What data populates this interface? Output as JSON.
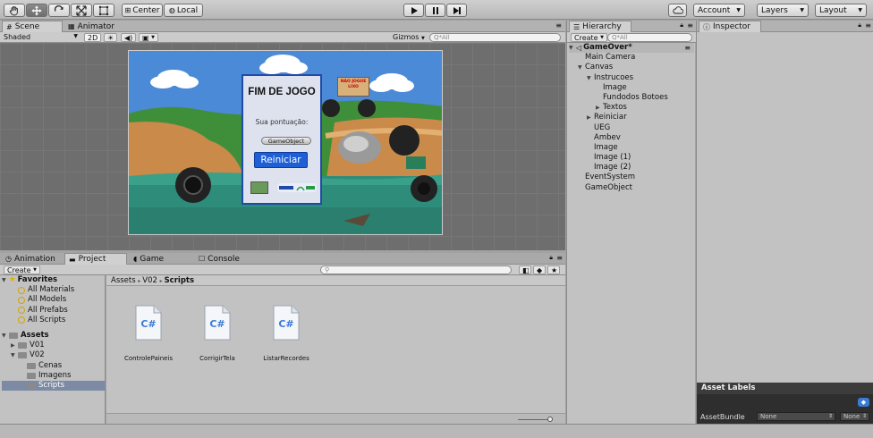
{
  "toolbar": {
    "center_label": "Center",
    "local_label": "Local",
    "account_label": "Account",
    "layers_label": "Layers",
    "layout_label": "Layout"
  },
  "scene_panel": {
    "tabs": [
      "Scene",
      "Animator"
    ],
    "shading": "Shaded",
    "mode_2d": "2D",
    "gizmos_label": "Gizmos",
    "search_placeholder": "Q*All"
  },
  "game_view": {
    "panel_title": "FIM DE JOGO",
    "score_label": "Sua pontuação:",
    "score_value": "GameObject",
    "restart_button": "Reiniciar",
    "sign_text": "NÃO JOGUE LIXO"
  },
  "hierarchy": {
    "tab": "Hierarchy",
    "create_label": "Create",
    "search_placeholder": "Q*All",
    "scene_name": "GameOver*",
    "items": [
      {
        "label": "Main Camera",
        "depth": 1,
        "arrow": ""
      },
      {
        "label": "Canvas",
        "depth": 1,
        "arrow": "down"
      },
      {
        "label": "Instrucoes",
        "depth": 2,
        "arrow": "down"
      },
      {
        "label": "Image",
        "depth": 3,
        "arrow": ""
      },
      {
        "label": "Fundodos Botoes",
        "depth": 3,
        "arrow": ""
      },
      {
        "label": "Textos",
        "depth": 3,
        "arrow": "right"
      },
      {
        "label": "Reiniciar",
        "depth": 2,
        "arrow": "right"
      },
      {
        "label": "UEG",
        "depth": 2,
        "arrow": ""
      },
      {
        "label": "Ambev",
        "depth": 2,
        "arrow": ""
      },
      {
        "label": "Image",
        "depth": 2,
        "arrow": ""
      },
      {
        "label": "Image (1)",
        "depth": 2,
        "arrow": ""
      },
      {
        "label": "Image (2)",
        "depth": 2,
        "arrow": ""
      },
      {
        "label": "EventSystem",
        "depth": 1,
        "arrow": ""
      },
      {
        "label": "GameObject",
        "depth": 1,
        "arrow": ""
      }
    ]
  },
  "inspector": {
    "tab": "Inspector",
    "asset_labels_title": "Asset Labels",
    "assetbundle_label": "AssetBundle",
    "assetbundle_value": "None",
    "variant_value": "None"
  },
  "bottom_panel": {
    "tabs": [
      "Animation",
      "Project",
      "Game",
      "Console"
    ],
    "create_label": "Create",
    "favorites": {
      "title": "Favorites",
      "items": [
        "All Materials",
        "All Models",
        "All Prefabs",
        "All Scripts"
      ]
    },
    "assets": {
      "title": "Assets",
      "folders": [
        {
          "label": "V01",
          "depth": 1,
          "arrow": "right"
        },
        {
          "label": "V02",
          "depth": 1,
          "arrow": "down"
        },
        {
          "label": "Cenas",
          "depth": 2,
          "arrow": ""
        },
        {
          "label": "Imagens",
          "depth": 2,
          "arrow": ""
        },
        {
          "label": "Scripts",
          "depth": 2,
          "arrow": ""
        }
      ]
    },
    "breadcrumb": [
      "Assets",
      "V02",
      "Scripts"
    ],
    "files": [
      "ControlePaineis",
      "CorrigirTela",
      "ListarRecordes"
    ],
    "file_icon_text": "C#"
  }
}
